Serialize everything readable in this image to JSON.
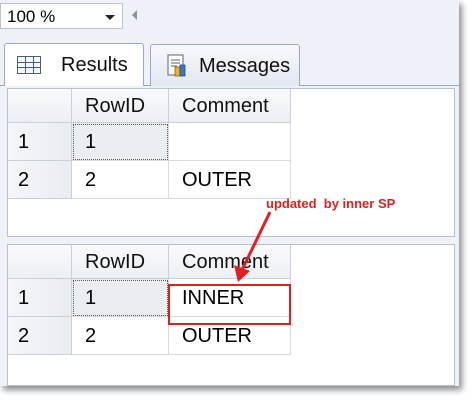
{
  "toolbar": {
    "zoom_value": "100 %",
    "zoom_dropdown_icon": "chevron-down-icon",
    "scroll_icon": "scroll-left-icon"
  },
  "tabs": [
    {
      "label": "Results",
      "icon": "grid-icon",
      "active": true
    },
    {
      "label": "Messages",
      "icon": "messages-icon",
      "active": false
    }
  ],
  "result_sets": [
    {
      "columns": [
        "RowID",
        "Comment"
      ],
      "rows": [
        {
          "num": "1",
          "RowID": "1",
          "Comment": ""
        },
        {
          "num": "2",
          "RowID": "2",
          "Comment": "OUTER"
        }
      ]
    },
    {
      "columns": [
        "RowID",
        "Comment"
      ],
      "rows": [
        {
          "num": "1",
          "RowID": "1",
          "Comment": "INNER"
        },
        {
          "num": "2",
          "RowID": "2",
          "Comment": "OUTER"
        }
      ]
    }
  ],
  "annotation": {
    "text": "updated  by inner SP",
    "color": "#e02020"
  },
  "colors": {
    "background": "#eef2f8",
    "annotation": "#e02020",
    "selection": "#eaeef3"
  }
}
